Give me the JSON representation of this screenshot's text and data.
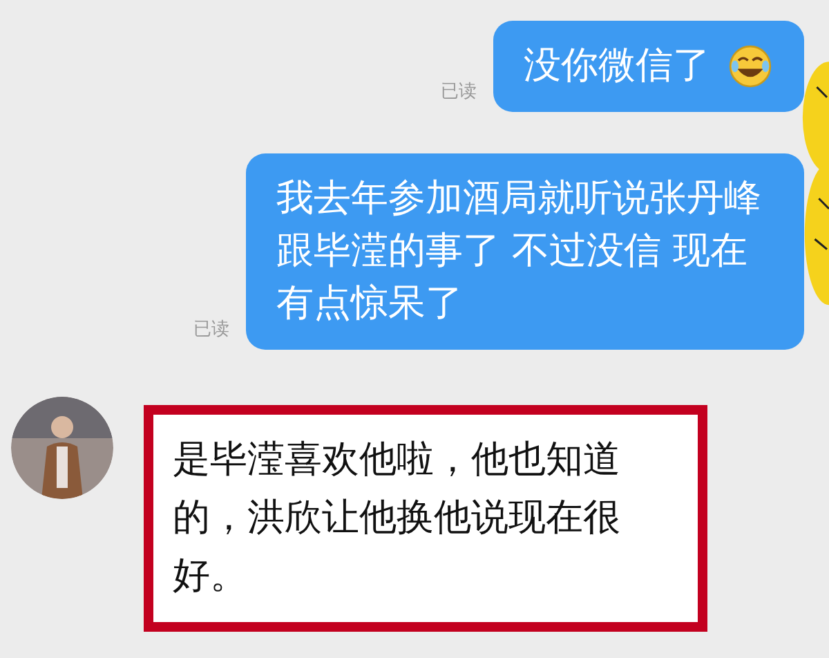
{
  "messages": [
    {
      "kind": "sent",
      "status": "已读",
      "text": "没你微信了",
      "emoji": true
    },
    {
      "kind": "sent",
      "status": "已读",
      "text": "我去年参加酒局就听说张丹峰跟毕滢的事了 不过没信 现在有点惊呆了",
      "emoji": false
    },
    {
      "kind": "received",
      "text": "是毕滢喜欢他啦，他也知道的，洪欣让他换他说现在很好。",
      "highlighted": true
    }
  ]
}
